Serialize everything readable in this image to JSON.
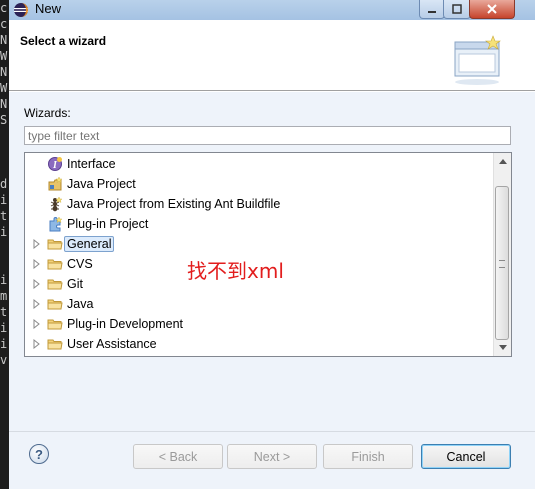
{
  "window": {
    "title": "New"
  },
  "header": {
    "title": "Select a wizard"
  },
  "wizards_label": "Wizards:",
  "filter": {
    "placeholder": "type filter text",
    "value": ""
  },
  "tree": {
    "items": [
      {
        "label": "Interface",
        "icon": "interface-icon",
        "expandable": false,
        "indent": 1
      },
      {
        "label": "Java Project",
        "icon": "java-project-icon",
        "expandable": false,
        "indent": 1
      },
      {
        "label": "Java Project from Existing Ant Buildfile",
        "icon": "ant-icon",
        "expandable": false,
        "indent": 1
      },
      {
        "label": "Plug-in Project",
        "icon": "plugin-project-icon",
        "expandable": false,
        "indent": 1
      },
      {
        "label": "General",
        "icon": "folder-icon",
        "expandable": true,
        "indent": 1,
        "selected": true
      },
      {
        "label": "CVS",
        "icon": "folder-icon",
        "expandable": true,
        "indent": 1
      },
      {
        "label": "Git",
        "icon": "folder-icon",
        "expandable": true,
        "indent": 1
      },
      {
        "label": "Java",
        "icon": "folder-icon",
        "expandable": true,
        "indent": 1
      },
      {
        "label": "Plug-in Development",
        "icon": "folder-icon",
        "expandable": true,
        "indent": 1
      },
      {
        "label": "User Assistance",
        "icon": "folder-icon",
        "expandable": true,
        "indent": 1
      }
    ]
  },
  "annotation": "找不到xml",
  "buttons": {
    "help": "?",
    "back": "< Back",
    "next": "Next >",
    "finish": "Finish",
    "cancel": "Cancel"
  },
  "background_strip": [
    "c",
    "c",
    "N",
    "W",
    "N",
    "W",
    "N",
    "S",
    "",
    "",
    "",
    "d",
    "i",
    "t",
    "i",
    "",
    "",
    "i",
    "m",
    "t",
    "i",
    "i",
    "v"
  ],
  "colors": {
    "selection": "#dcebfc",
    "annotation": "#e21d1d",
    "titlebar": "#b9d1ea"
  }
}
